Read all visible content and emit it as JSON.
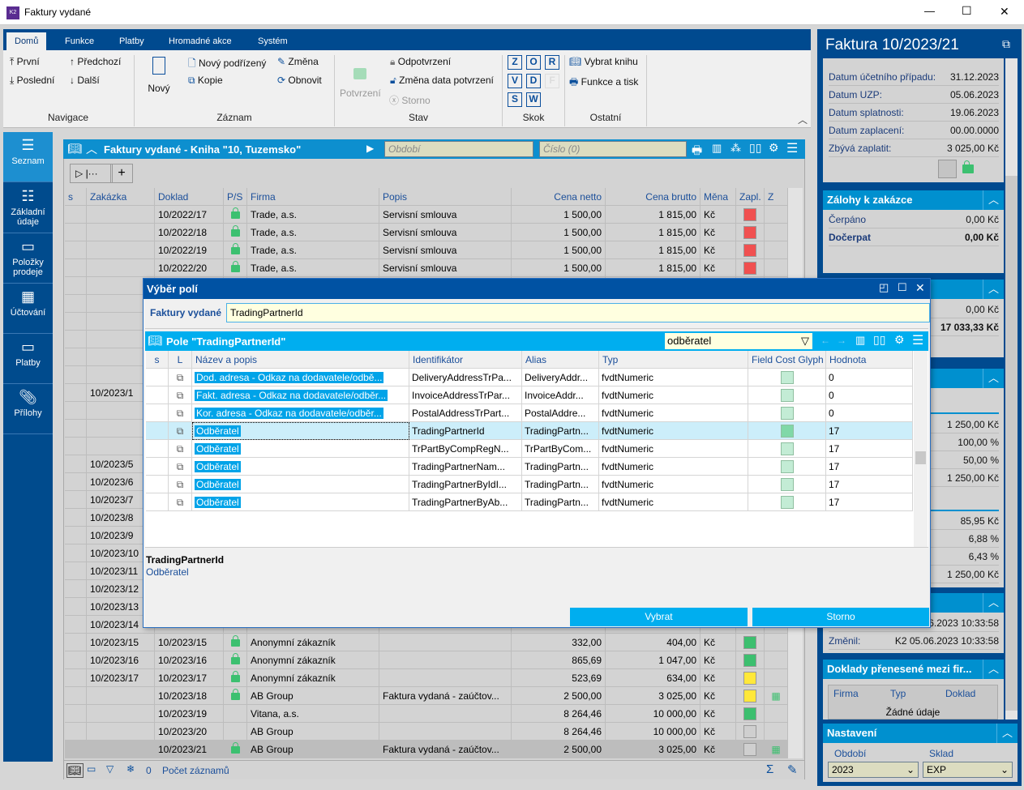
{
  "window": {
    "title": "Faktury vydané",
    "minimize": "—",
    "maximize": "☐",
    "close": "✕"
  },
  "ribbon": {
    "tabs": [
      "Domů",
      "Funkce",
      "Platby",
      "Hromadné akce",
      "Systém"
    ],
    "navigace": {
      "prvni": "První",
      "predchozi": "Předchozí",
      "posledni": "Poslední",
      "dalsi": "Další",
      "group": "Navigace"
    },
    "zaznam": {
      "novy": "Nový",
      "novy_podrizeny": "Nový podřízený",
      "zmena": "Změna",
      "kopie": "Kopie",
      "obnovit": "Obnovit",
      "group": "Záznam"
    },
    "stav": {
      "potvrzeni": "Potvrzení",
      "odpotvrzeni": "Odpotvrzení",
      "zmena_data": "Změna data potvrzení",
      "storno": "Storno",
      "group": "Stav"
    },
    "skok": {
      "keys": [
        "Z",
        "O",
        "R",
        "V",
        "D",
        "F",
        "S",
        "W"
      ],
      "group": "Skok"
    },
    "ostatni": {
      "vybrat_knihu": "Vybrat knihu",
      "funkce_tisk": "Funkce a tisk",
      "group": "Ostatní"
    }
  },
  "sidebar": [
    {
      "label": "Seznam",
      "icon": "menu-icon"
    },
    {
      "label": "Základní údaje",
      "icon": "list-icon"
    },
    {
      "label": "Položky prodeje",
      "icon": "box-icon"
    },
    {
      "label": "Účtování",
      "icon": "calculator-icon"
    },
    {
      "label": "Platby",
      "icon": "wallet-icon"
    },
    {
      "label": "Přílohy",
      "icon": "paperclip-icon"
    }
  ],
  "grid": {
    "title": "Faktury vydané - Kniha \"10, Tuzemsko\"",
    "period_placeholder": "Období",
    "number_placeholder": "Číslo (0)",
    "columns": [
      "s",
      "Zakázka",
      "Doklad",
      "P/S",
      "Firma",
      "Popis",
      "Cena netto",
      "Cena brutto",
      "Měna",
      "Zapl.",
      "Z"
    ],
    "rows": [
      {
        "zakazka": "",
        "doklad": "10/2022/17",
        "lock": true,
        "firma": "Trade, a.s.",
        "popis": "Servisní smlouva",
        "netto": "1 500,00",
        "brutto": "1 815,00",
        "mena": "Kč",
        "zapl": "#f05050",
        "z": false
      },
      {
        "zakazka": "",
        "doklad": "10/2022/18",
        "lock": true,
        "firma": "Trade, a.s.",
        "popis": "Servisní smlouva",
        "netto": "1 500,00",
        "brutto": "1 815,00",
        "mena": "Kč",
        "zapl": "#f05050",
        "z": false
      },
      {
        "zakazka": "",
        "doklad": "10/2022/19",
        "lock": true,
        "firma": "Trade, a.s.",
        "popis": "Servisní smlouva",
        "netto": "1 500,00",
        "brutto": "1 815,00",
        "mena": "Kč",
        "zapl": "#f05050",
        "z": false
      },
      {
        "zakazka": "",
        "doklad": "10/2022/20",
        "lock": true,
        "firma": "Trade, a.s.",
        "popis": "Servisní smlouva",
        "netto": "1 500,00",
        "brutto": "1 815,00",
        "mena": "Kč",
        "zapl": "#f05050",
        "z": false
      },
      {
        "zakazka": ""
      },
      {
        "zakazka": ""
      },
      {
        "zakazka": ""
      },
      {
        "zakazka": ""
      },
      {
        "zakazka": ""
      },
      {
        "zakazka": ""
      },
      {
        "zakazka": "10/2023/1"
      },
      {
        "zakazka": ""
      },
      {
        "zakazka": ""
      },
      {
        "zakazka": ""
      },
      {
        "zakazka": "10/2023/5"
      },
      {
        "zakazka": "10/2023/6"
      },
      {
        "zakazka": "10/2023/7"
      },
      {
        "zakazka": "10/2023/8"
      },
      {
        "zakazka": "10/2023/9"
      },
      {
        "zakazka": "10/2023/10"
      },
      {
        "zakazka": "10/2023/11"
      },
      {
        "zakazka": "10/2023/12"
      },
      {
        "zakazka": "10/2023/13"
      },
      {
        "zakazka": "10/2023/14"
      },
      {
        "zakazka": "10/2023/15",
        "doklad": "10/2023/15",
        "lock": true,
        "firma": "Anonymní zákazník",
        "popis": "",
        "netto": "332,00",
        "brutto": "404,00",
        "mena": "Kč",
        "zapl": "#3cbf6f",
        "z": false
      },
      {
        "zakazka": "10/2023/16",
        "doklad": "10/2023/16",
        "lock": true,
        "firma": "Anonymní zákazník",
        "popis": "",
        "netto": "865,69",
        "brutto": "1 047,00",
        "mena": "Kč",
        "zapl": "#3cbf6f",
        "z": false
      },
      {
        "zakazka": "10/2023/17",
        "doklad": "10/2023/17",
        "lock": true,
        "firma": "Anonymní zákazník",
        "popis": "",
        "netto": "523,69",
        "brutto": "634,00",
        "mena": "Kč",
        "zapl": "#ffe83a",
        "z": false
      },
      {
        "zakazka": "",
        "doklad": "10/2023/18",
        "lock": true,
        "firma": "AB Group",
        "popis": "Faktura vydaná - zaúčtov...",
        "netto": "2 500,00",
        "brutto": "3 025,00",
        "mena": "Kč",
        "zapl": "#ffe83a",
        "z": true
      },
      {
        "zakazka": "",
        "doklad": "10/2023/19",
        "lock": false,
        "firma": "Vitana, a.s.",
        "popis": "",
        "netto": "8 264,46",
        "brutto": "10 000,00",
        "mena": "Kč",
        "zapl": "#3cbf6f",
        "z": false
      },
      {
        "zakazka": "",
        "doklad": "10/2023/20",
        "lock": false,
        "firma": "AB Group",
        "popis": "",
        "netto": "8 264,46",
        "brutto": "10 000,00",
        "mena": "Kč",
        "zapl": "#cfcfcf",
        "z": false
      },
      {
        "zakazka": "",
        "doklad": "10/2023/21",
        "lock": true,
        "firma": "AB Group",
        "popis": "Faktura vydaná - zaúčtov...",
        "netto": "2 500,00",
        "brutto": "3 025,00",
        "mena": "Kč",
        "zapl": "#cfcfcf",
        "z": true,
        "selected": true
      }
    ],
    "status": {
      "count": "0",
      "record_count_label": "Počet záznamů"
    }
  },
  "right_panel": {
    "title": "Faktura 10/2023/21",
    "info": [
      [
        "Datum účetního případu:",
        "31.12.2023"
      ],
      [
        "Datum UZP:",
        "05.06.2023"
      ],
      [
        "Datum splatnosti:",
        "19.06.2023"
      ],
      [
        "Datum zaplacení:",
        "00.00.0000"
      ],
      [
        "Zbývá zaplatit:",
        "3 025,00 Kč"
      ]
    ],
    "zalohy": {
      "title": "Zálohy k zakázce",
      "rows": [
        [
          "Čerpáno",
          "0,00 Kč"
        ],
        [
          "Dočerpat",
          "0,00 Kč"
        ]
      ]
    },
    "section3": {
      "values": [
        "0,00 Kč",
        "17 033,33 Kč"
      ]
    },
    "section4": {
      "values": [
        "1 250,00 Kč",
        "100,00 %",
        "50,00 %",
        "1 250,00 Kč",
        "85,95 Kč",
        "6,88 %",
        "6,43 %",
        "1 250,00 Kč"
      ]
    },
    "section5": {
      "created": "06.2023 10:33:58",
      "changed_label": "Změnil:",
      "changed": "K2 05.06.2023 10:33:58"
    },
    "doklady": {
      "title": "Doklady přenesené mezi fir...",
      "columns": [
        "Firma",
        "Typ",
        "Doklad"
      ],
      "empty": "Žádné údaje"
    },
    "nastaveni": {
      "title": "Nastavení",
      "obdobi_label": "Období",
      "obdobi": "2023",
      "sklad_label": "Sklad",
      "sklad": "EXP"
    }
  },
  "dialog": {
    "title": "Výběr polí",
    "field_label": "Faktury vydané",
    "field_value": "TradingPartnerId",
    "grid_title": "Pole \"TradingPartnerId\"",
    "filter": "odběratel",
    "columns": [
      "s",
      "L",
      "Název a popis",
      "Identifikátor",
      "Alias",
      "Typ",
      "Field Cost Glyph",
      "Hodnota"
    ],
    "rows": [
      {
        "nazev": "Dod. adresa - Odkaz na dodavatele/odbě...",
        "id": "DeliveryAddressTrPa...",
        "alias": "DeliveryAddr...",
        "typ": "fvdtNumeric",
        "glyph": "#c3ecd5",
        "hodnota": "0"
      },
      {
        "nazev": "Fakt. adresa - Odkaz na dodavatele/odběr...",
        "id": "InvoiceAddressTrPar...",
        "alias": "InvoiceAddr...",
        "typ": "fvdtNumeric",
        "glyph": "#c3ecd5",
        "hodnota": "0"
      },
      {
        "nazev": "Kor. adresa - Odkaz na dodavatele/odběr...",
        "id": "PostalAddressTrPart...",
        "alias": "PostalAddre...",
        "typ": "fvdtNumeric",
        "glyph": "#c3ecd5",
        "hodnota": "0"
      },
      {
        "nazev": "Odběratel",
        "id": "TradingPartnerId",
        "alias": "TradingPartn...",
        "typ": "fvdtNumeric",
        "glyph": "#80d8a8",
        "hodnota": "17",
        "selected": true
      },
      {
        "nazev": "Odběratel",
        "id": "TrPartByCompRegN...",
        "alias": "TrPartByCom...",
        "typ": "fvdtNumeric",
        "glyph": "#c3ecd5",
        "hodnota": "17"
      },
      {
        "nazev": "Odběratel",
        "id": "TradingPartnerNam...",
        "alias": "TradingPartn...",
        "typ": "fvdtNumeric",
        "glyph": "#c3ecd5",
        "hodnota": "17"
      },
      {
        "nazev": "Odběratel",
        "id": "TradingPartnerByIdI...",
        "alias": "TradingPartn...",
        "typ": "fvdtNumeric",
        "glyph": "#c3ecd5",
        "hodnota": "17"
      },
      {
        "nazev": "Odběratel",
        "id": "TradingPartnerByAb...",
        "alias": "TradingPartn...",
        "typ": "fvdtNumeric",
        "glyph": "#c3ecd5",
        "hodnota": "17"
      }
    ],
    "info_title": "TradingPartnerId",
    "info_desc": "Odběratel",
    "select_button": "Vybrat",
    "cancel_button": "Storno"
  }
}
